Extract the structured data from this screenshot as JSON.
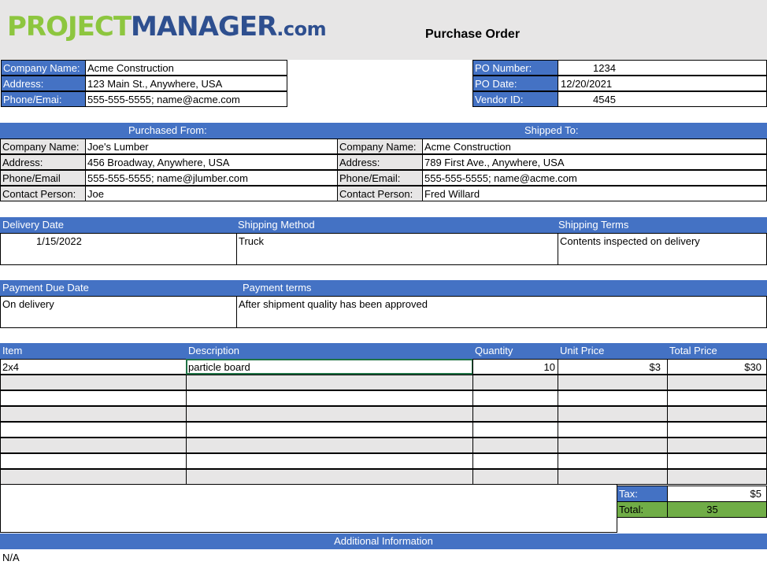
{
  "header": {
    "logo": {
      "part1": "PROJECT",
      "part2": "MANAGER",
      "part3": ".com"
    },
    "title": "Purchase Order"
  },
  "company": {
    "rows": [
      {
        "label": "Company Name:",
        "value": "Acme Construction"
      },
      {
        "label": "Address:",
        "value": "123 Main St., Anywhere, USA"
      },
      {
        "label": "Phone/Emai:",
        "value": "555-555-5555; name@acme.com"
      }
    ]
  },
  "po": {
    "rows": [
      {
        "label": "PO Number:",
        "value": "1234"
      },
      {
        "label": "PO Date:",
        "value": "12/20/2021"
      },
      {
        "label": "Vendor ID:",
        "value": "4545"
      }
    ]
  },
  "purchased_from": {
    "heading": "Purchased From:",
    "rows": [
      {
        "label": "Company Name:",
        "value": "Joe's Lumber"
      },
      {
        "label": "Address:",
        "value": "456 Broadway, Anywhere, USA"
      },
      {
        "label": "Phone/Email",
        "value": "555-555-5555; name@jlumber.com"
      },
      {
        "label": "Contact Person:",
        "value": "Joe"
      }
    ]
  },
  "shipped_to": {
    "heading": "Shipped To:",
    "rows": [
      {
        "label": "Company Name:",
        "value": "Acme Construction"
      },
      {
        "label": "Address:",
        "value": "789 First Ave., Anywhere, USA"
      },
      {
        "label": "Phone/Email:",
        "value": "555-555-5555; name@acme.com"
      },
      {
        "label": "Contact Person:",
        "value": "Fred Willard"
      }
    ]
  },
  "delivery": {
    "date_label": "Delivery Date",
    "method_label": "Shipping Method",
    "terms_label": "Shipping Terms",
    "date": "1/15/2022",
    "method": "Truck",
    "terms": "Contents inspected on delivery"
  },
  "payment": {
    "due_label": "Payment Due Date",
    "terms_label": "Payment terms",
    "due": "On delivery",
    "terms": "After shipment quality has been approved"
  },
  "items": {
    "headers": {
      "item": "Item",
      "description": "Description",
      "quantity": "Quantity",
      "unit_price": "Unit Price",
      "total_price": "Total Price"
    },
    "rows": [
      {
        "item": "2x4",
        "description": "particle board",
        "quantity": "10",
        "unit_price": "$3",
        "total_price": "$30"
      }
    ]
  },
  "totals": {
    "tax_label": "Tax:",
    "tax": "$5",
    "total_label": "Total:",
    "total": "35"
  },
  "additional": {
    "heading": "Additional Information",
    "text": "N/A"
  },
  "colors": {
    "header_blue": "#4472c4",
    "row_gray": "#e7e6e6",
    "total_green": "#70ad47",
    "logo_green": "#8dc63f",
    "logo_navy": "#2e4f8f"
  }
}
